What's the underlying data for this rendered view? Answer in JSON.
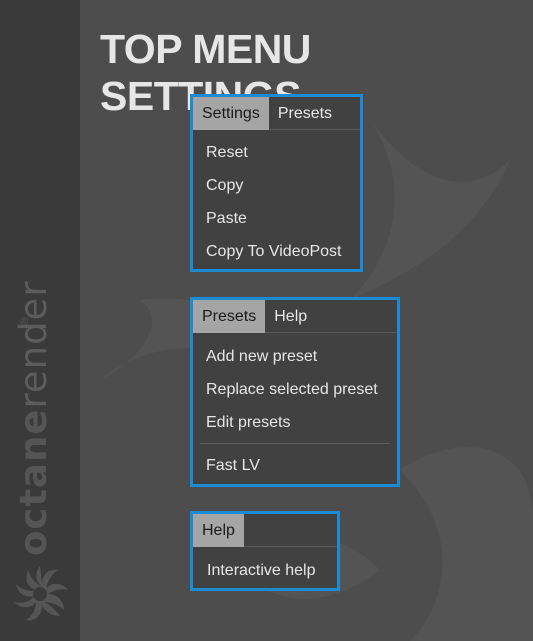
{
  "page": {
    "title": "TOP MENU SETTINGS"
  },
  "brand": {
    "name_bold": "octane",
    "name_light": "render",
    "registered": "®",
    "icon": "octane-logo-icon"
  },
  "panels": {
    "settings": {
      "tabs": [
        "Settings",
        "Presets"
      ],
      "items": [
        "Reset",
        "Copy",
        "Paste",
        "Copy To VideoPost"
      ]
    },
    "presets": {
      "tabs": [
        "Presets",
        "Help"
      ],
      "items": [
        "Add new preset",
        "Replace selected preset",
        "Edit presets"
      ],
      "extra_items": [
        "Fast LV"
      ]
    },
    "help": {
      "tabs": [
        "Help"
      ],
      "items": [
        "Interactive help"
      ]
    }
  },
  "colors": {
    "background": "#4d4d4d",
    "sidebar": "#3a3a3a",
    "highlight_border": "#1b8bd6",
    "active_tab": "#a5a5a5",
    "menu_bg": "#414141"
  }
}
